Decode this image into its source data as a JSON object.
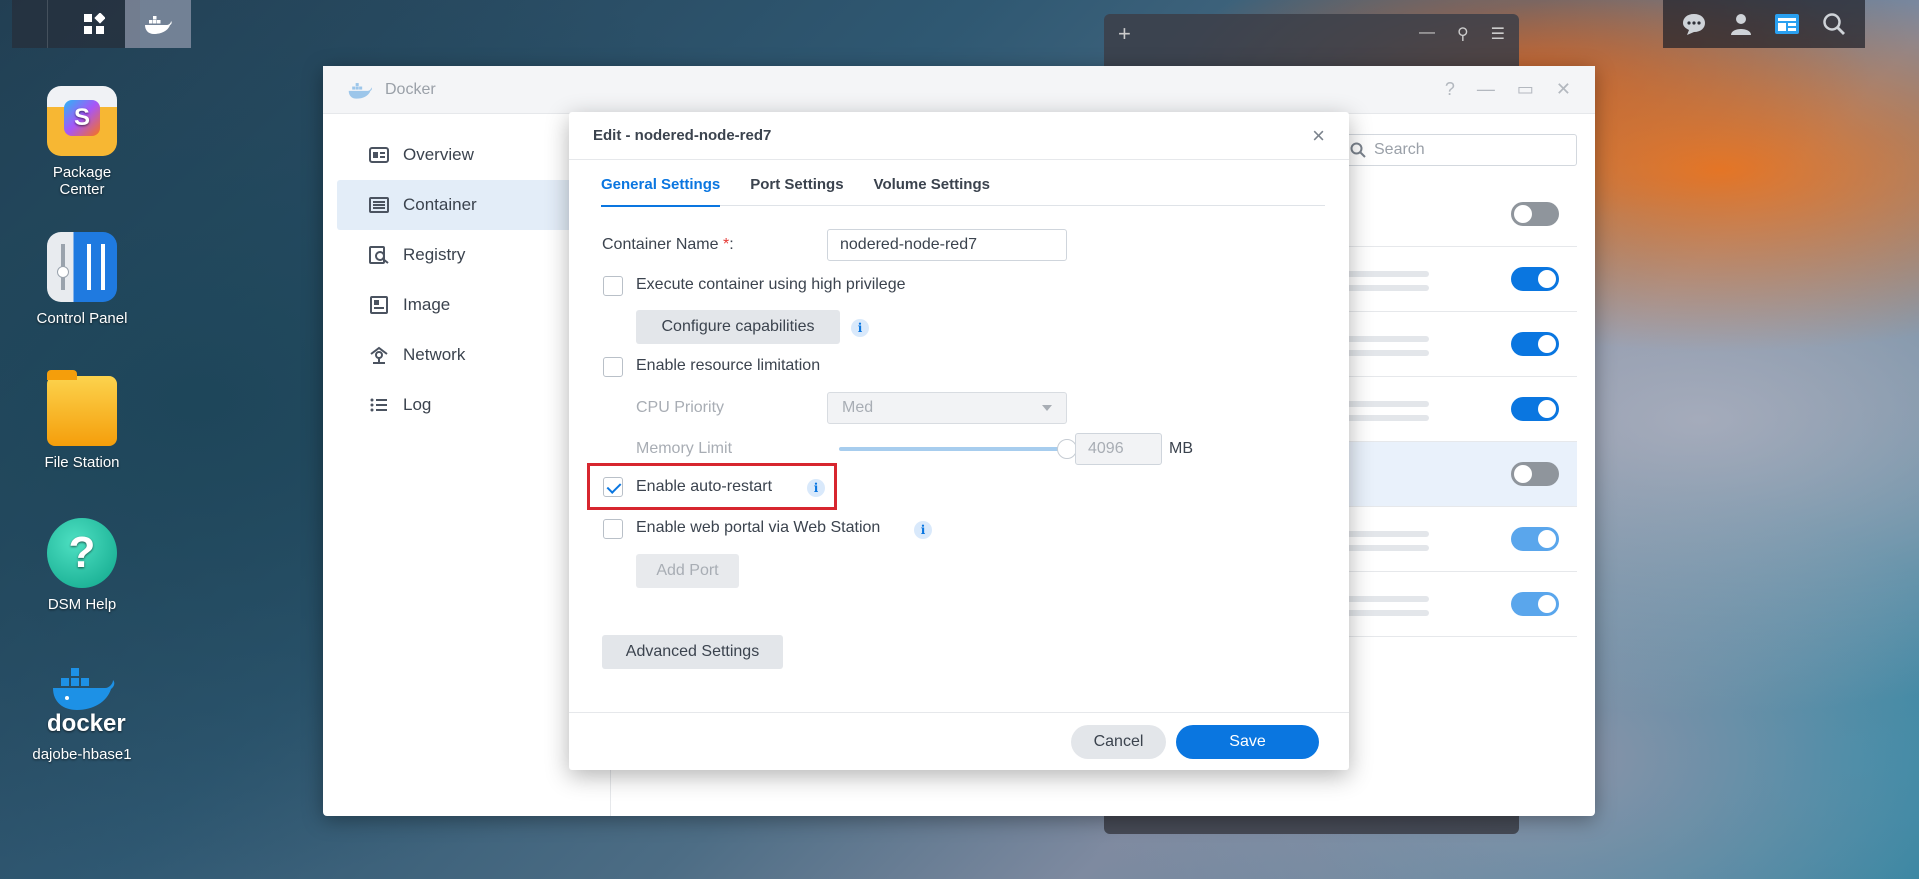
{
  "desktop": {
    "icons": [
      {
        "label_line1": "Package",
        "label_line2": "Center"
      },
      {
        "label_line1": "Control Panel",
        "label_line2": ""
      },
      {
        "label_line1": "File Station",
        "label_line2": ""
      },
      {
        "label_line1": "DSM Help",
        "label_line2": ""
      },
      {
        "label_line1": "dajobe-hbase1",
        "label_line2": ""
      }
    ],
    "docker_logo_text": "docker"
  },
  "docker_window": {
    "title": "Docker",
    "sidebar": [
      {
        "label": "Overview",
        "icon": "overview-icon"
      },
      {
        "label": "Container",
        "icon": "container-icon"
      },
      {
        "label": "Registry",
        "icon": "registry-icon"
      },
      {
        "label": "Image",
        "icon": "image-icon"
      },
      {
        "label": "Network",
        "icon": "network-icon"
      },
      {
        "label": "Log",
        "icon": "log-icon"
      }
    ],
    "active_sidebar": "Container",
    "search_placeholder": "Search",
    "toggles": [
      "off",
      "on",
      "on",
      "on",
      "off",
      "on",
      "on"
    ]
  },
  "dialog": {
    "title": "Edit - nodered-node-red7",
    "tabs": [
      "General Settings",
      "Port Settings",
      "Volume Settings"
    ],
    "active_tab": "General Settings",
    "container_name_label": "Container Name",
    "container_name_required": "*",
    "container_name_colon": ":",
    "container_name_value": "nodered-node-red7",
    "high_privilege_label": "Execute container using high privilege",
    "high_privilege_checked": false,
    "configure_capabilities": "Configure capabilities",
    "resource_limit_label": "Enable resource limitation",
    "resource_limit_checked": false,
    "cpu_priority_label": "CPU Priority",
    "cpu_priority_value": "Med",
    "memory_limit_label": "Memory Limit",
    "memory_limit_value": "4096",
    "memory_limit_unit": "MB",
    "auto_restart_label": "Enable auto-restart",
    "auto_restart_checked": true,
    "web_portal_label": "Enable web portal via Web Station",
    "web_portal_checked": false,
    "add_port": "Add Port",
    "advanced_settings": "Advanced Settings",
    "cancel": "Cancel",
    "save": "Save",
    "info_glyph": "i",
    "close_glyph": "×"
  },
  "colors": {
    "accent": "#0a76e0",
    "highlight": "#d7262f"
  }
}
